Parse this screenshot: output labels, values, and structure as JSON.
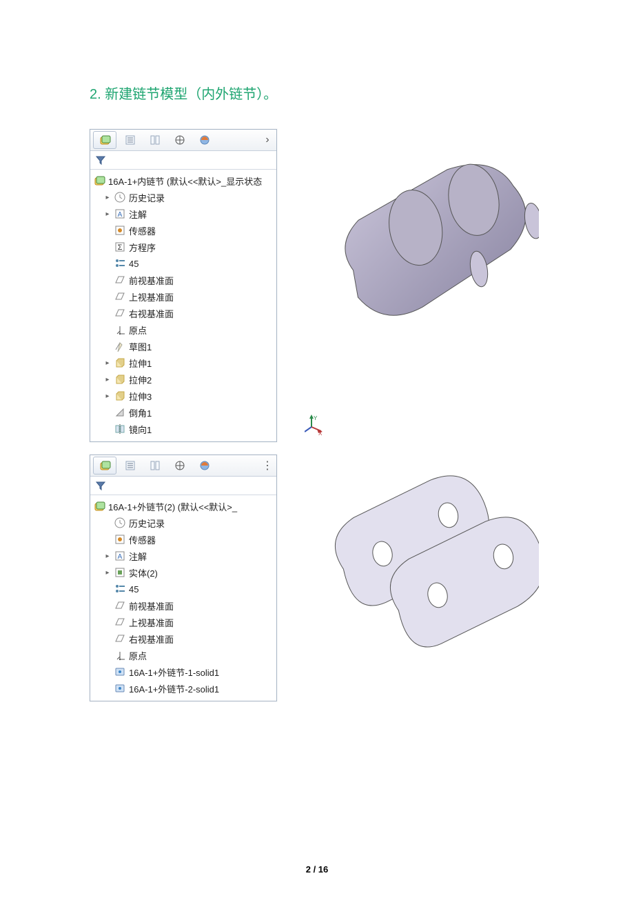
{
  "heading_num": "2.",
  "heading_text": "新建链节模型（内外链节）。",
  "panel1": {
    "root": "16A-1+内链节 (默认<<默认>_显示状态",
    "items": [
      {
        "exp": "▸",
        "icon": "history-icon",
        "label": "历史记录"
      },
      {
        "exp": "▸",
        "icon": "annotation-icon",
        "label": "注解"
      },
      {
        "exp": "",
        "icon": "sensor-icon",
        "label": "传感器"
      },
      {
        "exp": "",
        "icon": "equation-icon",
        "label": "方程序"
      },
      {
        "exp": "",
        "icon": "material-icon",
        "label": "45"
      },
      {
        "exp": "",
        "icon": "plane-icon",
        "label": "前视基准面"
      },
      {
        "exp": "",
        "icon": "plane-icon",
        "label": "上视基准面"
      },
      {
        "exp": "",
        "icon": "plane-icon",
        "label": "右视基准面"
      },
      {
        "exp": "",
        "icon": "origin-icon",
        "label": "原点"
      },
      {
        "exp": "",
        "icon": "sketch-icon",
        "label": "草图1"
      },
      {
        "exp": "▸",
        "icon": "extrude-icon",
        "label": "拉伸1"
      },
      {
        "exp": "▸",
        "icon": "extrude-icon",
        "label": "拉伸2"
      },
      {
        "exp": "▸",
        "icon": "extrude-icon",
        "label": "拉伸3"
      },
      {
        "exp": "",
        "icon": "chamfer-icon",
        "label": "倒角1"
      },
      {
        "exp": "",
        "icon": "mirror-icon",
        "label": "镜向1"
      }
    ]
  },
  "panel2": {
    "root": "16A-1+外链节(2) (默认<<默认>_",
    "items": [
      {
        "exp": "",
        "icon": "history-icon",
        "label": "历史记录"
      },
      {
        "exp": "",
        "icon": "sensor-icon",
        "label": "传感器"
      },
      {
        "exp": "▸",
        "icon": "annotation-icon",
        "label": "注解"
      },
      {
        "exp": "▸",
        "icon": "solidbody-icon",
        "label": "实体(2)"
      },
      {
        "exp": "",
        "icon": "material-icon",
        "label": "45"
      },
      {
        "exp": "",
        "icon": "plane-icon",
        "label": "前视基准面"
      },
      {
        "exp": "",
        "icon": "plane-icon",
        "label": "上视基准面"
      },
      {
        "exp": "",
        "icon": "plane-icon",
        "label": "右视基准面"
      },
      {
        "exp": "",
        "icon": "origin-icon",
        "label": "原点"
      },
      {
        "exp": "",
        "icon": "importedbody-icon",
        "label": "16A-1+外链节-1-solid1"
      },
      {
        "exp": "",
        "icon": "importedbody-icon",
        "label": "16A-1+外链节-2-solid1"
      }
    ]
  },
  "footer_page": "2",
  "footer_sep": " / ",
  "footer_total": "16"
}
